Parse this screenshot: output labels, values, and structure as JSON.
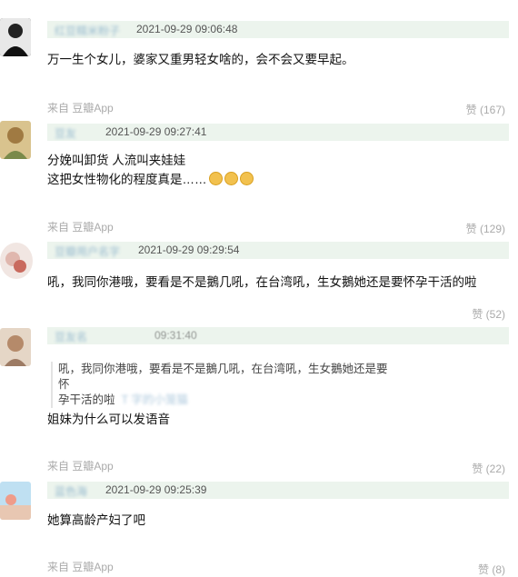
{
  "comments": [
    {
      "author": "红豆糯米粉子",
      "time": "2021-09-29 09:06:48",
      "lines": [
        "万一生个女儿，婆家又重男轻女啥的，会不会又要早起。"
      ],
      "source": "来自 豆瓣App",
      "votes": "赞 (167)",
      "avatar_color": "#3a3a3a"
    },
    {
      "author": "豆友",
      "time": "2021-09-29 09:27:41",
      "lines": [
        "分娩叫卸货 人流叫夹娃娃",
        "这把女性物化的程度真是……"
      ],
      "source": "来自 豆瓣App",
      "votes": "赞 (129)",
      "avatar_color": "#c9a86a"
    },
    {
      "author": "豆瓣用户名字",
      "time": "2021-09-29 09:29:54",
      "lines": [
        "吼，我同你港哦，要看是不是鵝几吼，在台湾吼，生女鵝她还是要怀孕干活的啦"
      ],
      "votes": "赞 (52)",
      "avatar_color": "#d8b2a6"
    },
    {
      "author": "豆友名",
      "time": "09:31:40",
      "quote_lines": [
        "吼，我同你港哦，要看是不是鵝几吼，在台湾吼，生女鵝她还是要怀",
        "孕干活的啦"
      ],
      "quote_author": "T 字的小笼猫",
      "lines": [
        "姐妹为什么可以发语音"
      ],
      "source": "来自 豆瓣App",
      "votes": "赞 (22)",
      "avatar_color": "#caa78f"
    },
    {
      "author": "蓝色海",
      "time": "2021-09-29 09:25:39",
      "lines": [
        "她算高龄产妇了吧"
      ],
      "source": "来自 豆瓣App",
      "votes": "赞 (8)",
      "avatar_color": "#9fc7e3"
    }
  ]
}
